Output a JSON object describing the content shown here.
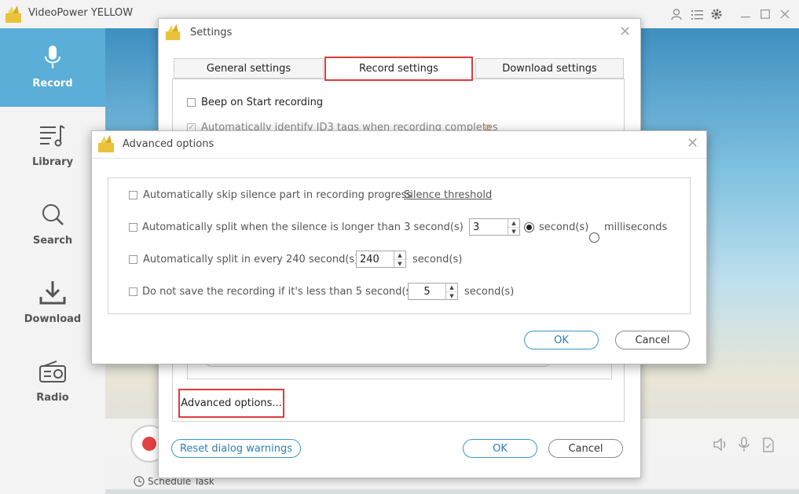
{
  "app": {
    "title": "VideoPower YELLOW"
  },
  "sidebar": {
    "items": [
      {
        "label": "Record",
        "icon": "microphone-icon",
        "active": true
      },
      {
        "label": "Library",
        "icon": "music-list-icon"
      },
      {
        "label": "Search",
        "icon": "search-icon"
      },
      {
        "label": "Download",
        "icon": "download-icon"
      },
      {
        "label": "Radio",
        "icon": "radio-icon"
      }
    ]
  },
  "player": {
    "schedule_label": "Schedule Task"
  },
  "settings": {
    "title": "Settings",
    "tabs": [
      {
        "label": "General settings"
      },
      {
        "label": "Record settings",
        "active": true
      },
      {
        "label": "Download settings"
      }
    ],
    "options": {
      "beep": "Beep on Start recording",
      "id3": "Automatically identify ID3 tags when recording completes"
    },
    "advanced_button": "Advanced options...",
    "reset_button": "Reset dialog warnings",
    "ok": "OK",
    "cancel": "Cancel"
  },
  "advanced": {
    "title": "Advanced options",
    "skip_silence": {
      "label": "Automatically skip silence part in recording progress",
      "link": "Silence threshold",
      "checked": false
    },
    "split_silence": {
      "label": "Automatically split when the silence is longer than 3 second(s)",
      "value": "3",
      "unit_seconds": "second(s)",
      "unit_ms": "milliseconds",
      "selected_unit": "seconds",
      "checked": false
    },
    "split_every": {
      "label": "Automatically split in every 240 second(s)",
      "value": "240",
      "unit": "second(s)",
      "checked": false
    },
    "min_length": {
      "label": "Do not save the recording if it's less than 5 second(s)",
      "value": "5",
      "unit": "second(s)",
      "checked": false
    },
    "ok": "OK",
    "cancel": "Cancel"
  },
  "colors": {
    "accent": "#5aaed8",
    "highlight": "#e13a3a",
    "record": "#e34040",
    "link_button": "#3a97c8"
  }
}
